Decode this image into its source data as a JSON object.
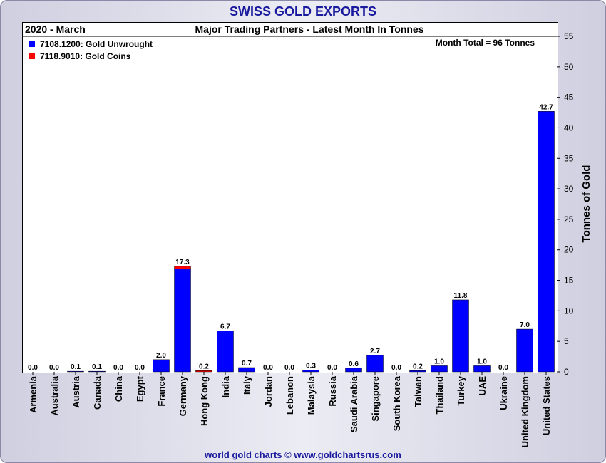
{
  "header": {
    "title": "SWISS GOLD EXPORTS",
    "period": "2020 - March",
    "subtitle": "Major Trading Partners - Latest Month In Tonnes",
    "month_total": "Month Total = 96 Tonnes"
  },
  "footer": {
    "credit": "world gold charts © www.goldchartsrus.com"
  },
  "colors": {
    "unwrought": "#0000ff",
    "coins": "#ff0000",
    "title": "#1a1a9e"
  },
  "chart_data": {
    "type": "bar",
    "stacked": true,
    "categories": [
      "Armenia",
      "Australia",
      "Austria",
      "Canada",
      "China",
      "Egypt",
      "France",
      "Germany",
      "Hong Kong",
      "India",
      "Italy",
      "Jordan",
      "Lebanon",
      "Malaysia",
      "Russia",
      "Saudi Arabia",
      "Singapore",
      "South Korea",
      "Taiwan",
      "Thailand",
      "Turkey",
      "UAE",
      "Ukraine",
      "United Kingdom",
      "United States"
    ],
    "series": [
      {
        "name": "7108.1200: Gold Unwrought",
        "color": "#0000ff",
        "values": [
          0.0,
          0.0,
          0.1,
          0.1,
          0.0,
          0.0,
          2.0,
          16.9,
          0.0,
          6.7,
          0.7,
          0.0,
          0.0,
          0.3,
          0.0,
          0.6,
          2.7,
          0.0,
          0.2,
          1.0,
          11.8,
          1.0,
          0.0,
          7.0,
          42.7
        ]
      },
      {
        "name": "7118.9010: Gold Coins",
        "color": "#ff0000",
        "values": [
          0.0,
          0.0,
          0.0,
          0.0,
          0.0,
          0.0,
          0.0,
          0.4,
          0.2,
          0.0,
          0.0,
          0.0,
          0.0,
          0.0,
          0.0,
          0.0,
          0.0,
          0.0,
          0.0,
          0.0,
          0.0,
          0.0,
          0.0,
          0.0,
          0.0
        ]
      }
    ],
    "totals": [
      "0.0",
      "0.0",
      "0.1",
      "0.1",
      "0.0",
      "0.0",
      "2.0",
      "17.3",
      "0.2",
      "6.7",
      "0.7",
      "0.0",
      "0.0",
      "0.3",
      "0.0",
      "0.6",
      "2.7",
      "0.0",
      "0.2",
      "1.0",
      "11.8",
      "1.0",
      "0.0",
      "7.0",
      "42.7"
    ],
    "ylabel": "Tonnes of Gold",
    "ylim": [
      0,
      55
    ],
    "yticks": [
      0,
      5,
      10,
      15,
      20,
      25,
      30,
      35,
      40,
      45,
      50,
      55
    ],
    "y_axis_side": "right",
    "legend": "top-left",
    "grid": false
  }
}
